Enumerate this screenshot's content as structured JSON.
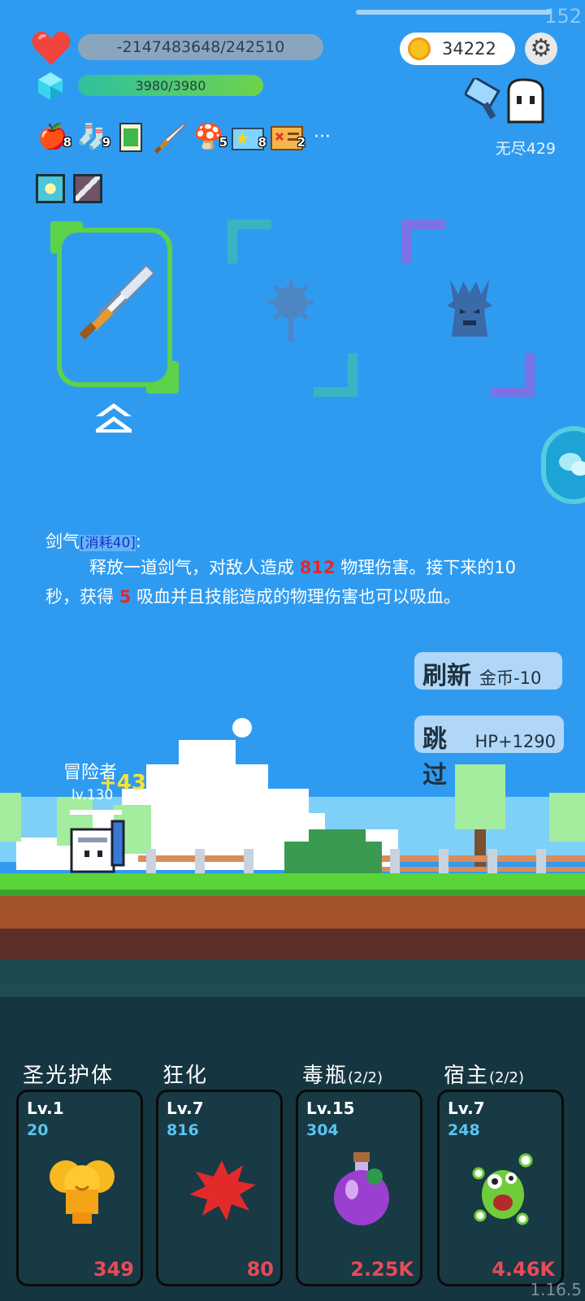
{
  "status": {
    "fps": "152",
    "hp_text": "-2147483648/242510",
    "mp_text": "3980/3980",
    "coins": "34222",
    "endless_label": "无尽429"
  },
  "inventory": [
    {
      "icon": "apple-icon",
      "count": "8"
    },
    {
      "icon": "sock-icon",
      "count": "9"
    },
    {
      "icon": "card-icon",
      "count": ""
    },
    {
      "icon": "sword-icon",
      "count": ""
    },
    {
      "icon": "mushroom-icon",
      "count": "5"
    },
    {
      "icon": "star-ticket-icon",
      "count": "8"
    },
    {
      "icon": "map-icon",
      "count": "2"
    }
  ],
  "inventory_more": "···",
  "skill_desc": {
    "name": "剑气",
    "cost": "[消耗40]",
    "colon": ":",
    "part1": "释放一道剑气，对敌人造成 ",
    "damage": "812",
    "part2": " 物理伤害。接下来的10秒，获得 ",
    "lifesteal": "5",
    "part3": " 吸血并且技能造成的物理伤害也可以吸血。"
  },
  "actions": {
    "refresh_label": "刷新",
    "refresh_cost": "金币-10",
    "skip_label": "跳过",
    "skip_reward": "HP+1290"
  },
  "hero": {
    "name": "冒险者",
    "level": "lv.130",
    "heal_popup": "+43"
  },
  "skills": [
    {
      "name": "圣光护体",
      "uses": "",
      "level": "Lv.1",
      "value": "20",
      "cost": "349",
      "icon": "holy-shield-icon"
    },
    {
      "name": "狂化",
      "uses": "",
      "level": "Lv.7",
      "value": "816",
      "cost": "80",
      "icon": "rage-splat-icon"
    },
    {
      "name": "毒瓶",
      "uses": "(2/2)",
      "level": "Lv.15",
      "value": "304",
      "cost": "2.25K",
      "icon": "poison-bottle-icon"
    },
    {
      "name": "宿主",
      "uses": "(2/2)",
      "level": "Lv.7",
      "value": "248",
      "cost": "4.46K",
      "icon": "parasite-monster-icon"
    }
  ],
  "version": "1.16.5",
  "colors": {
    "sky": "#2f9bf0",
    "selected_border": "#5bd24a",
    "damage_red": "#e8262c",
    "cost_red": "#e94a58",
    "value_blue": "#5ac4ef"
  }
}
